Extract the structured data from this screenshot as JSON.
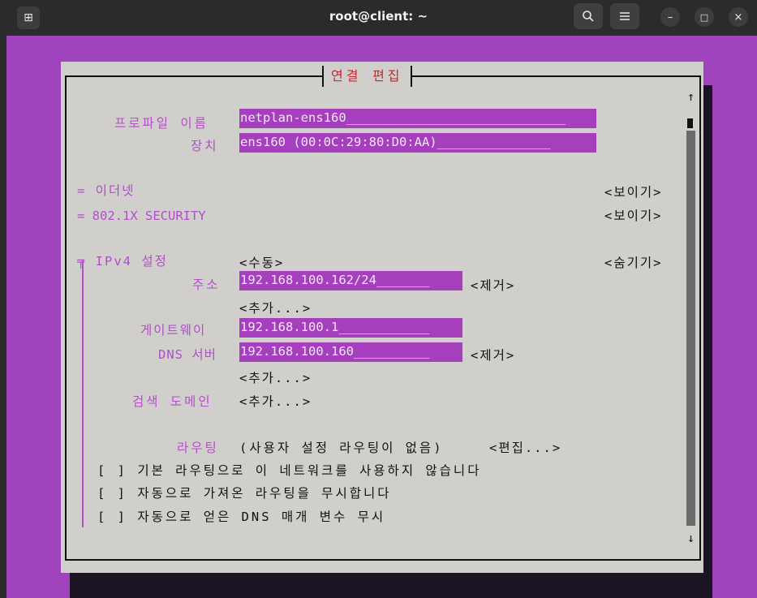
{
  "window": {
    "title": "root@client: ~",
    "new_tab_icon": "⊞",
    "search_icon": "🔍",
    "menu_icon": "☰",
    "min_icon": "–",
    "max_icon": "□",
    "close_icon": "×"
  },
  "dialog": {
    "title": "연결 편집",
    "profile_label": "프로파일 이름",
    "profile_value": "netplan-ens160_____________________________",
    "device_label": "장치",
    "device_value": "ens160 (00:0C:29:80:D0:AA)_______________",
    "ethernet_label": "= 이더넷",
    "ethernet_action": "<보이기>",
    "security_label": "= 802.1X SECURITY",
    "security_action": "<보이기>",
    "ipv4_label": "╤ IPv4 설정",
    "ipv4_mode": "<수동>",
    "ipv4_action": "<숨기기>",
    "address_label": "주소",
    "address_value": "192.168.100.162/24_______",
    "address_remove": "<제거>",
    "address_add": "<추가...>",
    "gateway_label": "게이트웨이",
    "gateway_value": "192.168.100.1____________",
    "dns_label": "DNS 서버",
    "dns_value": "192.168.100.160__________",
    "dns_remove": "<제거>",
    "dns_add": "<추가...>",
    "search_domain_label": "검색 도메인",
    "search_domain_add": "<추가...>",
    "routing_label": "라우팅",
    "routing_value": "(사용자 설정 라우팅이 없음)",
    "routing_edit": "<편집...>",
    "check1": "[ ] 기본 라우팅으로 이 네트워크를 사용하지 않습니다",
    "check2": "[ ] 자동으로 가져온 라우팅을 무시합니다",
    "check3": "[ ] 자동으로 얻은 DNS 매개 변수 무시",
    "scroll_up": "↑",
    "scroll_down": "↓"
  },
  "colors": {
    "terminal_bg": "#a044bd",
    "dialog_bg": "#d1cfcc",
    "field_bg": "#a63fbe",
    "label": "#b04fc8",
    "title": "#c6262e"
  }
}
